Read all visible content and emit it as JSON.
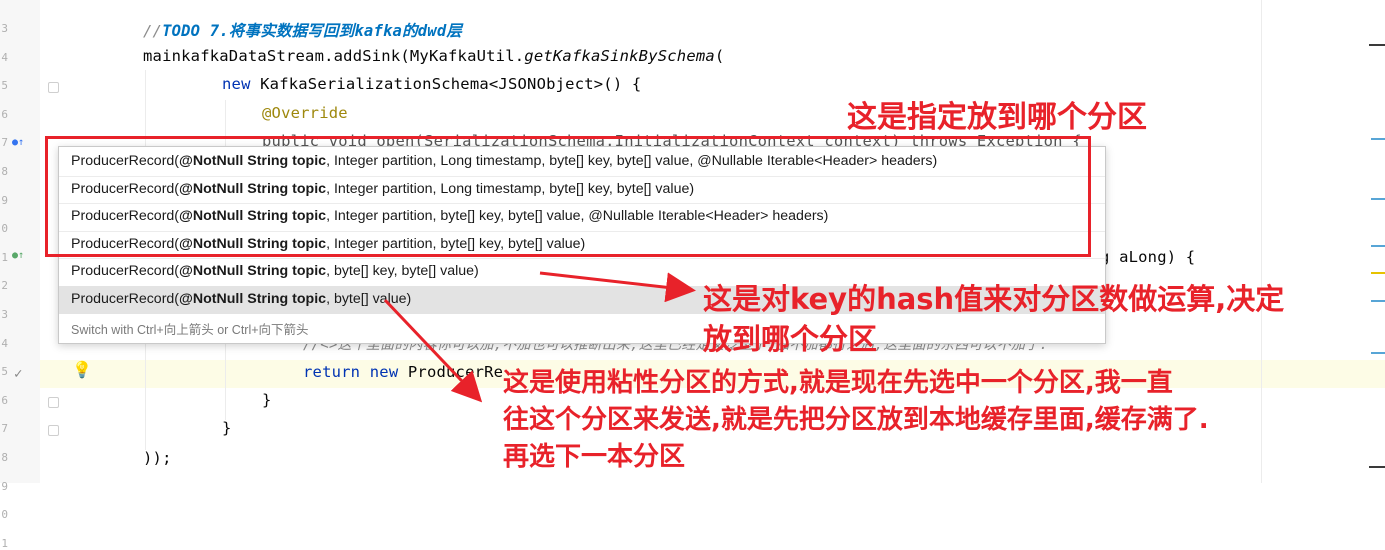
{
  "editor": {
    "line_numbers": [
      "3",
      "4",
      "5",
      "6",
      "7",
      "8",
      "9",
      "0",
      "1",
      "2",
      "3",
      "4",
      "5",
      "6",
      "7",
      "8",
      "9",
      "0",
      "1"
    ],
    "lines": {
      "todo_prefix": "//",
      "todo_text": "TODO 7.将事实数据写回到kafka的dwd层",
      "l2_a": "mainkafkaDataStream.addSink(MyKafkaUtil.",
      "l2_b": "getKafkaSinkBySchema",
      "l2_c": "(",
      "l3_kw": "new",
      "l3_rest": " KafkaSerializationSchema<JSONObject>() {",
      "l4": "@Override",
      "l5_partial": "public void open(SerializationSchema.InitializationContext context) throws Exception {",
      "l9_tail": "g aLong) {",
      "l11_comment": "//<>这个里面的内容你可以加,不加也可以推断出来,这里已经定义泛型了,加不加都行之后,这里面的东西可以不加了.",
      "l12_kw1": "return",
      "l12_kw2": "new",
      "l12_rest": " ProducerRe",
      "l13": "}",
      "l14": "}",
      "l15": "));",
      "l16": "..."
    }
  },
  "popup": {
    "items": [
      {
        "prefix": "ProducerRecord(",
        "bold": "@NotNull String topic",
        "rest": ", Integer partition, Long timestamp, byte[] key, byte[] value, @Nullable Iterable<Header> headers)"
      },
      {
        "prefix": "ProducerRecord(",
        "bold": "@NotNull String topic",
        "rest": ", Integer partition, Long timestamp, byte[] key, byte[] value)"
      },
      {
        "prefix": "ProducerRecord(",
        "bold": "@NotNull String topic",
        "rest": ", Integer partition, byte[] key, byte[] value, @Nullable Iterable<Header> headers)"
      },
      {
        "prefix": "ProducerRecord(",
        "bold": "@NotNull String topic",
        "rest": ", Integer partition, byte[] key, byte[] value)"
      },
      {
        "prefix": "ProducerRecord(",
        "bold": "@NotNull String topic",
        "rest": ", byte[] key, byte[] value)"
      },
      {
        "prefix": "ProducerRecord(",
        "bold": "@NotNull String topic",
        "rest": ", byte[] value)"
      }
    ],
    "hint": "Switch with Ctrl+向上箭头 or Ctrl+向下箭头"
  },
  "annotations": {
    "partition": "这是指定放到哪个分区",
    "hash_line1": "这是对key的hash值来对分区数做运算,决定",
    "hash_line2": "放到哪个分区",
    "sticky_line1": "这是使用粘性分区的方式,就是现在先选中一个分区,我一直",
    "sticky_line2": "往这个分区来发送,就是先把分区放到本地缓存里面,缓存满了.",
    "sticky_line3": "再选下一本分区"
  },
  "colors": {
    "annotation_red": "#e8222a",
    "keyword": "#0033b3",
    "annotation": "#9e880d",
    "comment": "#8c8c8c"
  }
}
